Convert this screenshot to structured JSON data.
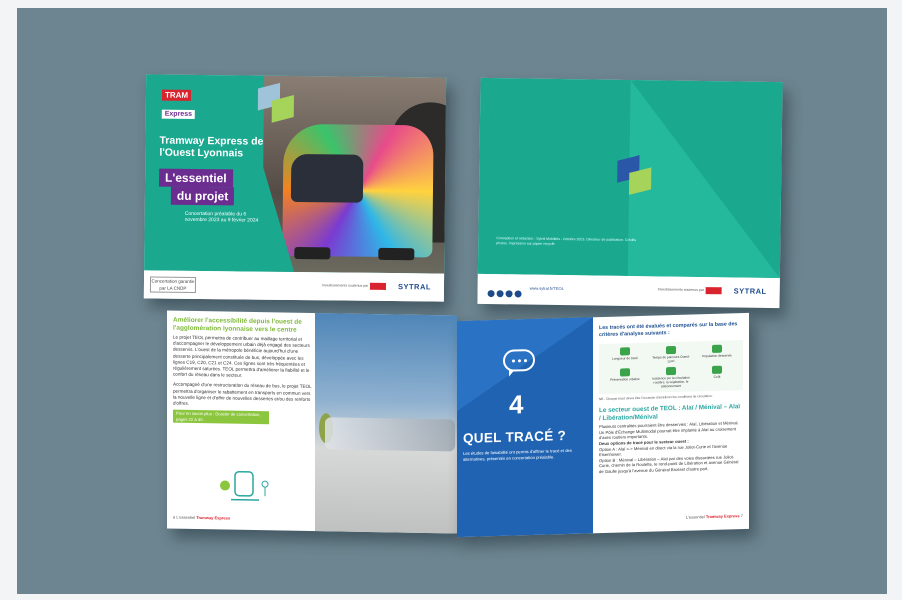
{
  "cover": {
    "badge_top": "TRAM",
    "badge_bottom": "Express",
    "title": "Tramway Express de l'Ouest Lyonnais",
    "pill_1": "L'essentiel",
    "pill_2": "du projet",
    "subtitle": "Concertation préalable du 6 novembre 2023 au 9 février 2024",
    "bottom_left_logo": "Concertation garantie par LA CNDP",
    "bottom_small": "Investissements soutenus par",
    "brand": "SYTRAL"
  },
  "back_cover": {
    "small_text": "Conception et rédaction : Sytral Mobilités - Octobre 2023. Directeur de publication. Crédits photos. Impression sur papier recyclé.",
    "url": "www.sytral.fr/TEOL",
    "bottom_small": "Investissements soutenus par",
    "brand": "SYTRAL"
  },
  "booklet_left": {
    "heading": "Améliorer l'accessibilité depuis l'ouest de l'agglomération lyonnaise vers le centre",
    "p1": "Le projet TEOL permettra de contribuer au maillage territorial et d'accompagner le développement urbain déjà engagé des secteurs desservis. L'ouest de la métropole bénéficie aujourd'hui d'une desserte principalement constituée de bus, développée avec les lignes C19, C20, C21 et C24. Ces lignes sont très fréquentées et régulièrement saturées. TEOL permettra d'améliorer la fiabilité et le confort du réseau dans le secteur.",
    "p2": "Accompagné d'une restructuration du réseau de bus, le projet TEOL permettra d'organiser le rabattement en transports en commun vers la nouvelle ligne et d'offrir de nouvelles dessertes et/ou des renforts d'offres.",
    "green_bar": "Pour en savoir plus : Dossier de concertation, pages 22 à 30",
    "footer_page": "6",
    "footer_text": "L'essentiel",
    "footer_brand": "Tramway Express"
  },
  "booklet_right": {
    "number": "4",
    "title": "QUEL TRACÉ ?",
    "blue_sub": "Les études de faisabilité ont permis d'affiner le tracé et des alternatives, présentés en concertation préalable.",
    "criteria_head": "Les tracés ont été évalués et comparés sur la base des critères d'analyse suivants :",
    "criteria": [
      "Longueur de tracé",
      "Temps de parcours Ouest-Lyon",
      "Population desservie",
      "Préservation urbaine",
      "Incidence sur la circulation routière, la végétation, le stationnement",
      "Coût"
    ],
    "criteria_note": "NB : Chaque tracé devra être l'occasion d'améliorer les conditions de circulation.",
    "section_title": "Le secteur ouest de TEOL : Alaï / Ménival – Alaï / Libération/Ménival",
    "bullet_1": "Plusieurs centralités pourraient être desservies : Alaï, Libération et Ménival.",
    "bullet_2": "Un Pôle d'Échange Multimodal pourrait être implanté à Alaï au croisement d'axes routiers importants.",
    "two_options": "Deux options de tracé pour le secteur ouest :",
    "option_a": "Option A : Alaï <-> Ménival en direct via la rue Joliot-Curie et l'avenue Eisenhower.",
    "option_b": "Option B : Ménival – Libération – Alaï par des voies dissociées rue Joliot-Curie, chemin de la Roulette, le rond-point de Libération et avenue Général de Gaulle jusqu'à l'avenue du Général Brosset d'autre part.",
    "footer_text": "L'essentiel",
    "footer_brand": "Tramway Express",
    "footer_page": "7"
  },
  "colors": {
    "teal": "#1aa88f",
    "purple": "#6b2d8f",
    "blue": "#1f63b2",
    "green": "#8cc63f",
    "background": "#6d8590"
  }
}
